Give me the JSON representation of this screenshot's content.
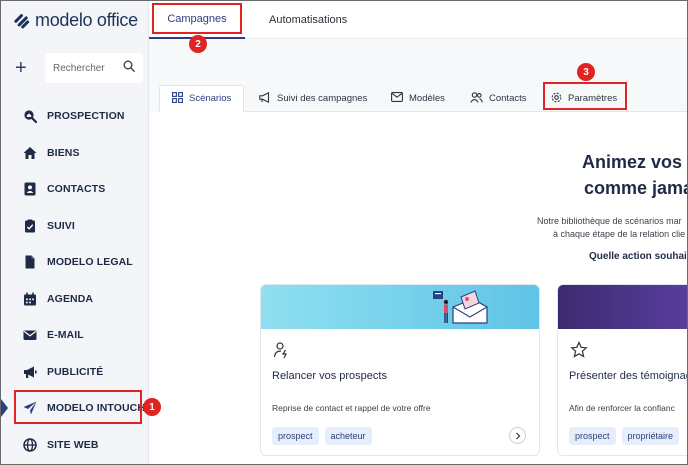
{
  "app": {
    "logo_text": "modelo office"
  },
  "sidebar": {
    "search_placeholder": "Rechercher",
    "items": [
      {
        "label": "PROSPECTION",
        "icon": "search-house-icon"
      },
      {
        "label": "BIENS",
        "icon": "house-icon"
      },
      {
        "label": "CONTACTS",
        "icon": "contact-card-icon"
      },
      {
        "label": "SUIVI",
        "icon": "clipboard-check-icon"
      },
      {
        "label": "MODELO LEGAL",
        "icon": "document-icon"
      },
      {
        "label": "AGENDA",
        "icon": "calendar-icon"
      },
      {
        "label": "E-MAIL",
        "icon": "envelope-icon"
      },
      {
        "label": "PUBLICITÉ",
        "icon": "megaphone-icon"
      },
      {
        "label": "MODELO INTOUCH",
        "icon": "paper-plane-icon"
      },
      {
        "label": "SITE WEB",
        "icon": "globe-icon"
      }
    ]
  },
  "top_tabs": {
    "campagnes": "Campagnes",
    "automatisations": "Automatisations"
  },
  "sub_tabs": {
    "scenarios": "Scénarios",
    "suivi": "Suivi des campagnes",
    "modeles": "Modèles",
    "contacts": "Contacts",
    "parametres": "Paramètres"
  },
  "hero": {
    "title_line1": "Animez vos r",
    "title_line2": "comme jama",
    "desc_line1": "Notre bibliothèque de scénarios mar",
    "desc_line2": "à chaque étape de la relation clie",
    "question": "Quelle action souhai"
  },
  "cards": [
    {
      "title": "Relancer vos prospects",
      "subtitle": "Reprise de contact et rappel de votre offre",
      "tags": [
        "prospect",
        "acheteur"
      ],
      "icon": "user-bolt-icon"
    },
    {
      "title": "Présenter des témoignag",
      "subtitle": "Afin de renforcer la confianc",
      "tags": [
        "prospect",
        "propriétaire"
      ],
      "icon": "star-icon"
    }
  ],
  "callouts": [
    "1",
    "2",
    "3"
  ],
  "colors": {
    "accent": "#2a3f80",
    "callout": "#e02323",
    "tag_bg": "#e6eefb"
  }
}
